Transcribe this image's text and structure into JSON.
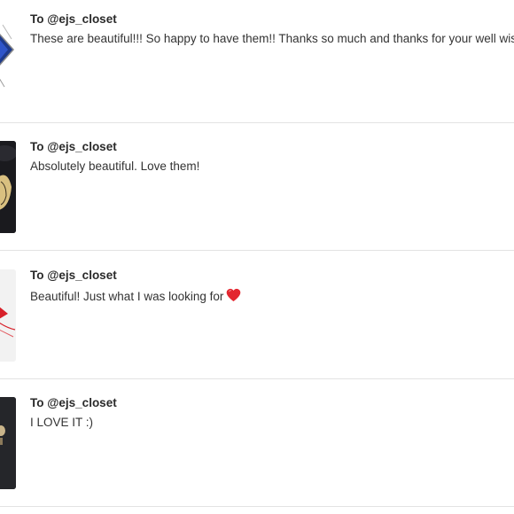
{
  "reviews": [
    {
      "to": "To @ejs_closet",
      "text": "These are beautiful!!! So happy to have them!! Thanks so much and thanks for your well wishes."
    },
    {
      "to": "To @ejs_closet",
      "text": "Absolutely beautiful. Love them!"
    },
    {
      "to": "To @ejs_closet",
      "text": "Beautiful! Just what I was looking for",
      "emoji": "heart-icon"
    },
    {
      "to": "To @ejs_closet",
      "text": "I LOVE IT :)"
    }
  ],
  "colors": {
    "divider": "#e3e3e3",
    "heart": "#e3262f"
  }
}
